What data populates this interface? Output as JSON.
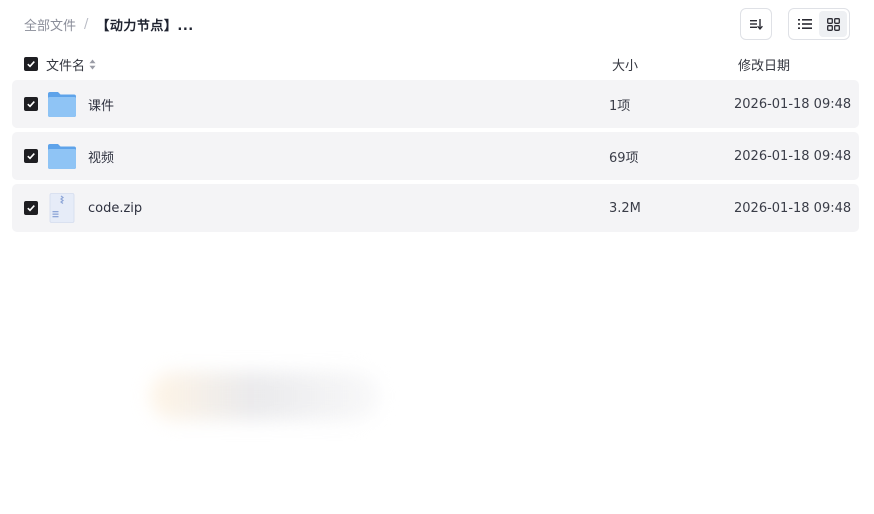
{
  "breadcrumb": {
    "root": "全部文件",
    "separator": "/",
    "current": "【动力节点】..."
  },
  "toolbar": {
    "sort_icon": "sort-icon",
    "list_view_icon": "list-view-icon",
    "grid_view_icon": "grid-view-icon"
  },
  "columns": {
    "name": "文件名",
    "size": "大小",
    "date": "修改日期"
  },
  "files": [
    {
      "name": "课件",
      "size": "1项",
      "date": "2026-01-18 09:48",
      "type": "folder",
      "checked": true
    },
    {
      "name": "视频",
      "size": "69项",
      "date": "2026-01-18 09:48",
      "type": "folder",
      "checked": true
    },
    {
      "name": "code.zip",
      "size": "3.2M",
      "date": "2026-01-18 09:48",
      "type": "zip",
      "checked": true
    }
  ],
  "colors": {
    "row_bg": "#f4f4f6",
    "checkbox": "#1e1e22",
    "folder": "#7fb8f0"
  }
}
